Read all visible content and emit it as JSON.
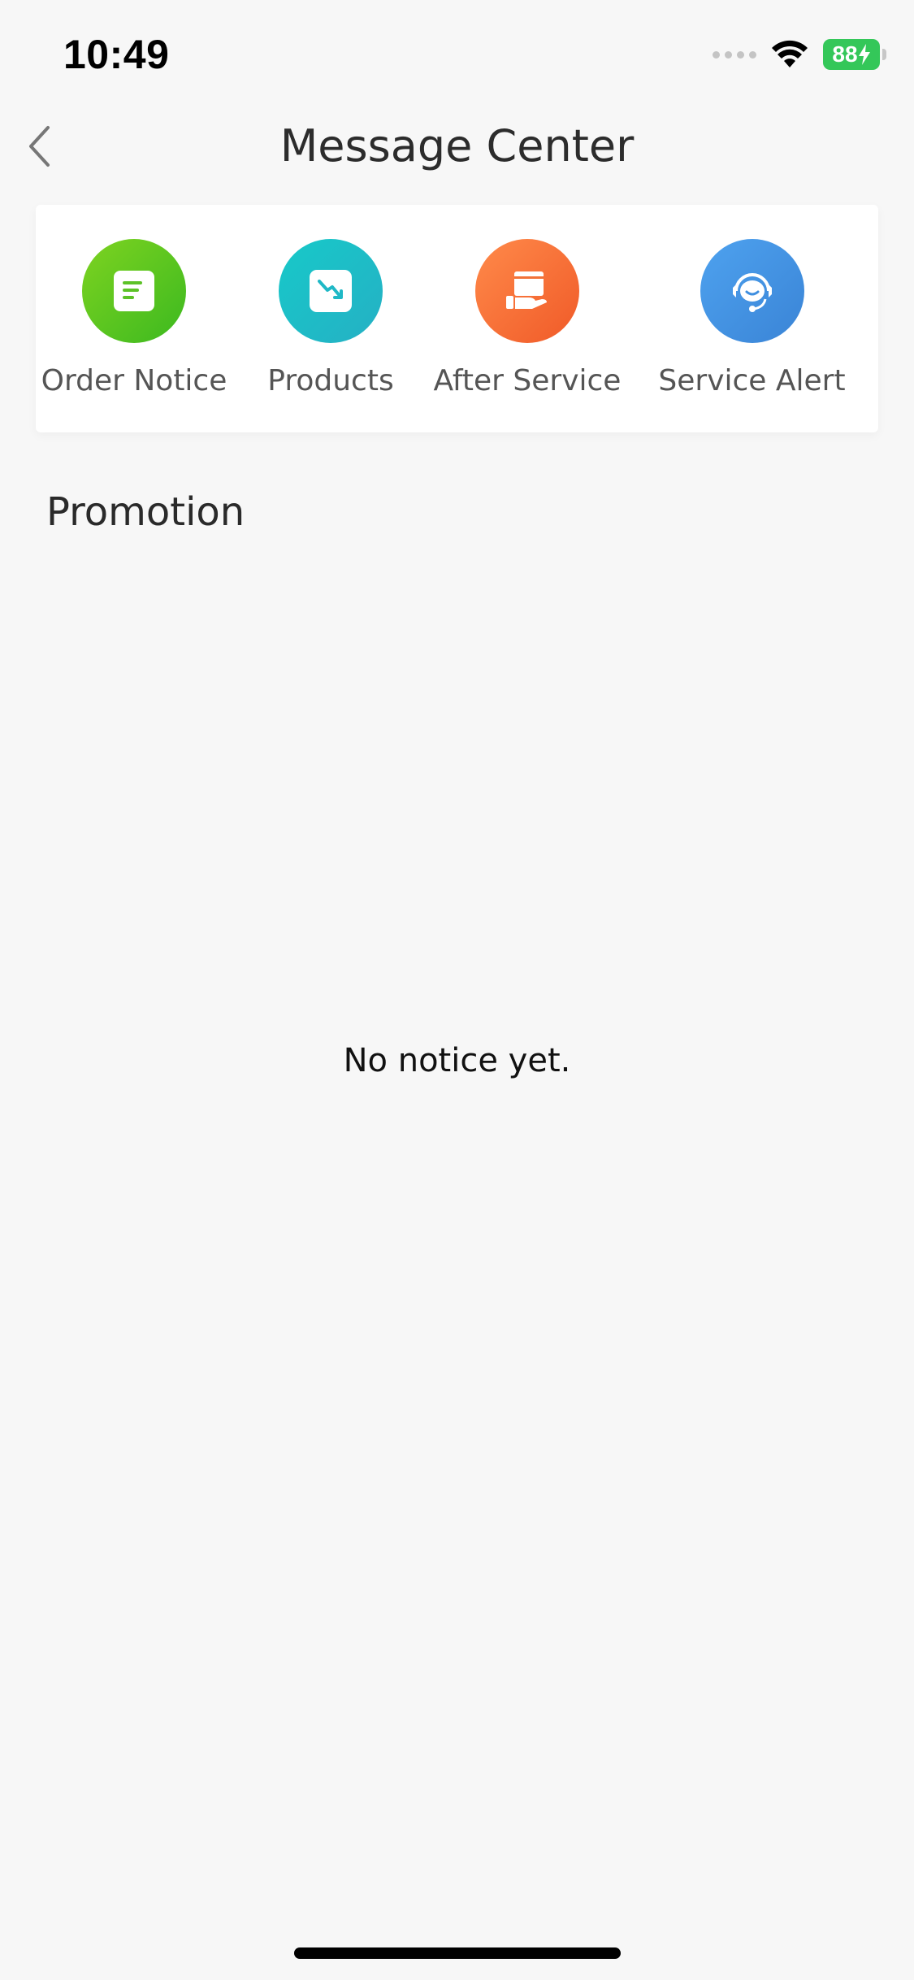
{
  "status_bar": {
    "time": "10:49",
    "battery": "88",
    "battery_color": "#34c759"
  },
  "nav": {
    "title": "Message Center",
    "back_icon": "chevron-left-icon"
  },
  "categories": [
    {
      "label": "Order Notice",
      "icon": "document-icon",
      "color_start": "#7ed321",
      "color_end": "#3cb91f"
    },
    {
      "label": "Products",
      "icon": "price-drop-icon",
      "color_start": "#17c9c9",
      "color_end": "#25b0c4"
    },
    {
      "label": "After Service",
      "icon": "service-hand-icon",
      "color_start": "#ff8a4a",
      "color_end": "#f05a28"
    },
    {
      "label": "Service Alert",
      "icon": "headset-icon",
      "color_start": "#4ea2ef",
      "color_end": "#3a84d6"
    }
  ],
  "promotion": {
    "title": "Promotion",
    "empty_text": "No notice yet."
  }
}
